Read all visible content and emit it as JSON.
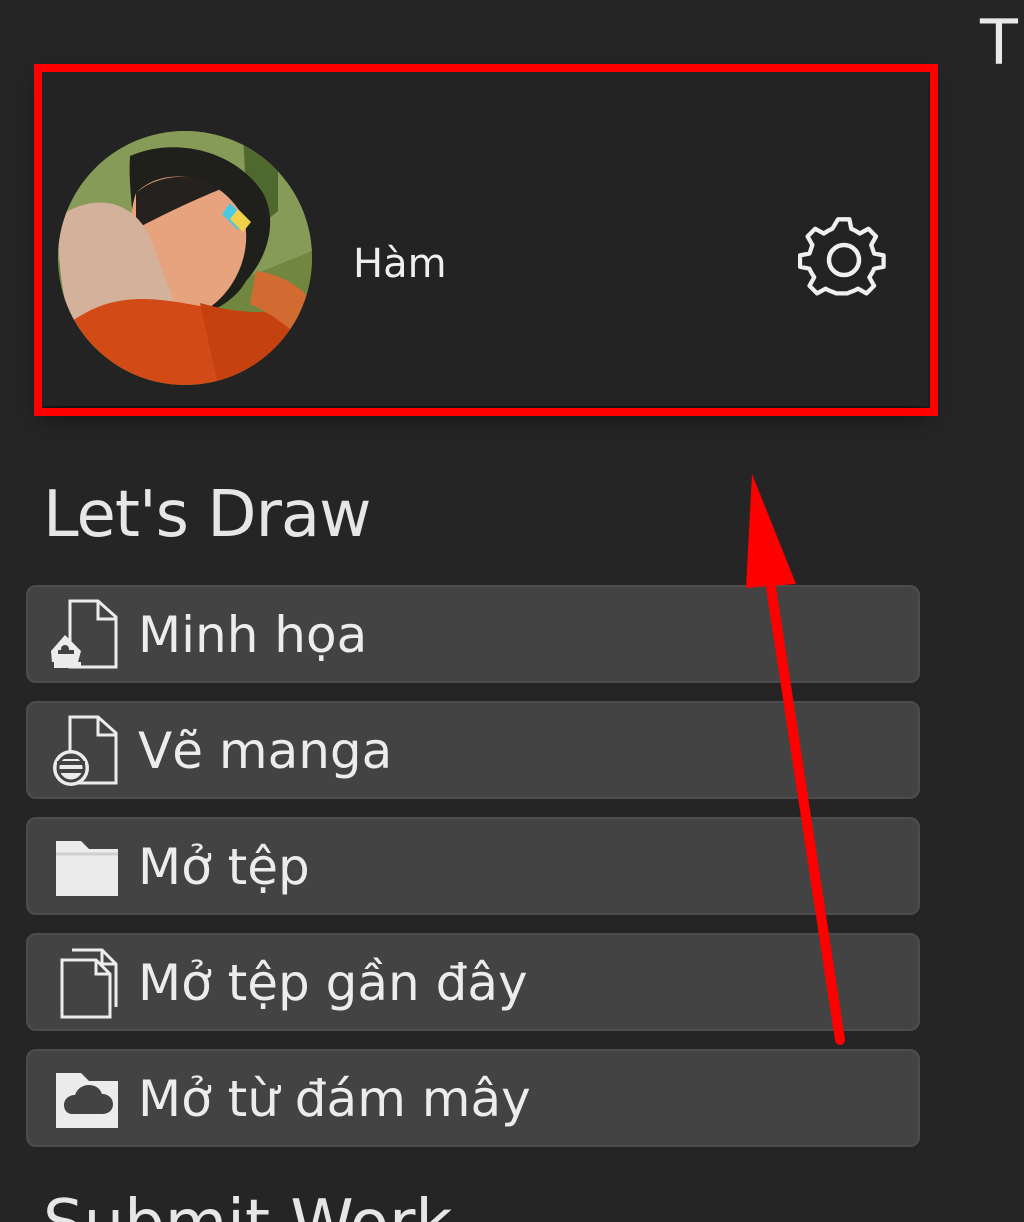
{
  "top_right_letter": "T",
  "profile": {
    "username": "Hàm",
    "avatar_icon": "user-avatar-photo",
    "settings_icon": "gear-icon"
  },
  "lets_draw": {
    "title": "Let's Draw",
    "items": [
      {
        "label": "Minh họa",
        "icon": "illustration-file-icon"
      },
      {
        "label": "Vẽ manga",
        "icon": "manga-file-icon"
      },
      {
        "label": "Mở tệp",
        "icon": "folder-icon"
      },
      {
        "label": "Mở tệp gần đây",
        "icon": "recent-files-icon"
      },
      {
        "label": "Mở từ đám mây",
        "icon": "cloud-folder-icon"
      }
    ]
  },
  "submit_work": {
    "title": "Submit Work"
  },
  "colors": {
    "background": "#252525",
    "menu_item": "#434343",
    "highlight": "#ff0000"
  }
}
